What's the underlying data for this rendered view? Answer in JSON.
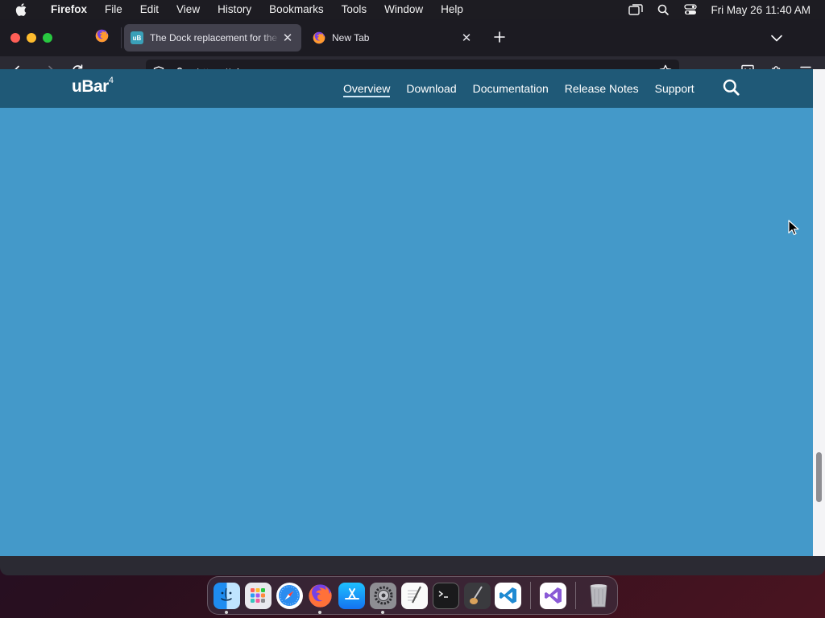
{
  "menubar": {
    "app": "Firefox",
    "items": [
      "File",
      "Edit",
      "View",
      "History",
      "Bookmarks",
      "Tools",
      "Window",
      "Help"
    ],
    "clock": "Fri May 26  11:40 AM"
  },
  "tabs": {
    "active": {
      "title": "The Dock replacement for the Mac",
      "favicon": "uB"
    },
    "inactive": {
      "title": "New Tab"
    }
  },
  "url": {
    "scheme": "https://",
    "host": "ubarapp.com"
  },
  "site": {
    "logo": "uBar",
    "logo_sup": "4",
    "nav": [
      "Overview",
      "Download",
      "Documentation",
      "Release Notes",
      "Support"
    ],
    "active_nav": "Overview",
    "accent_header": "#1f5977",
    "accent_body": "#4499c9"
  },
  "dock": [
    "finder-icon",
    "launchpad-icon",
    "safari-icon",
    "firefox-icon",
    "app-store-icon",
    "system-settings-icon",
    "textedit-icon",
    "terminal-icon",
    "instruments-icon",
    "vscode-icon",
    "visual-studio-icon",
    "trash-icon"
  ]
}
